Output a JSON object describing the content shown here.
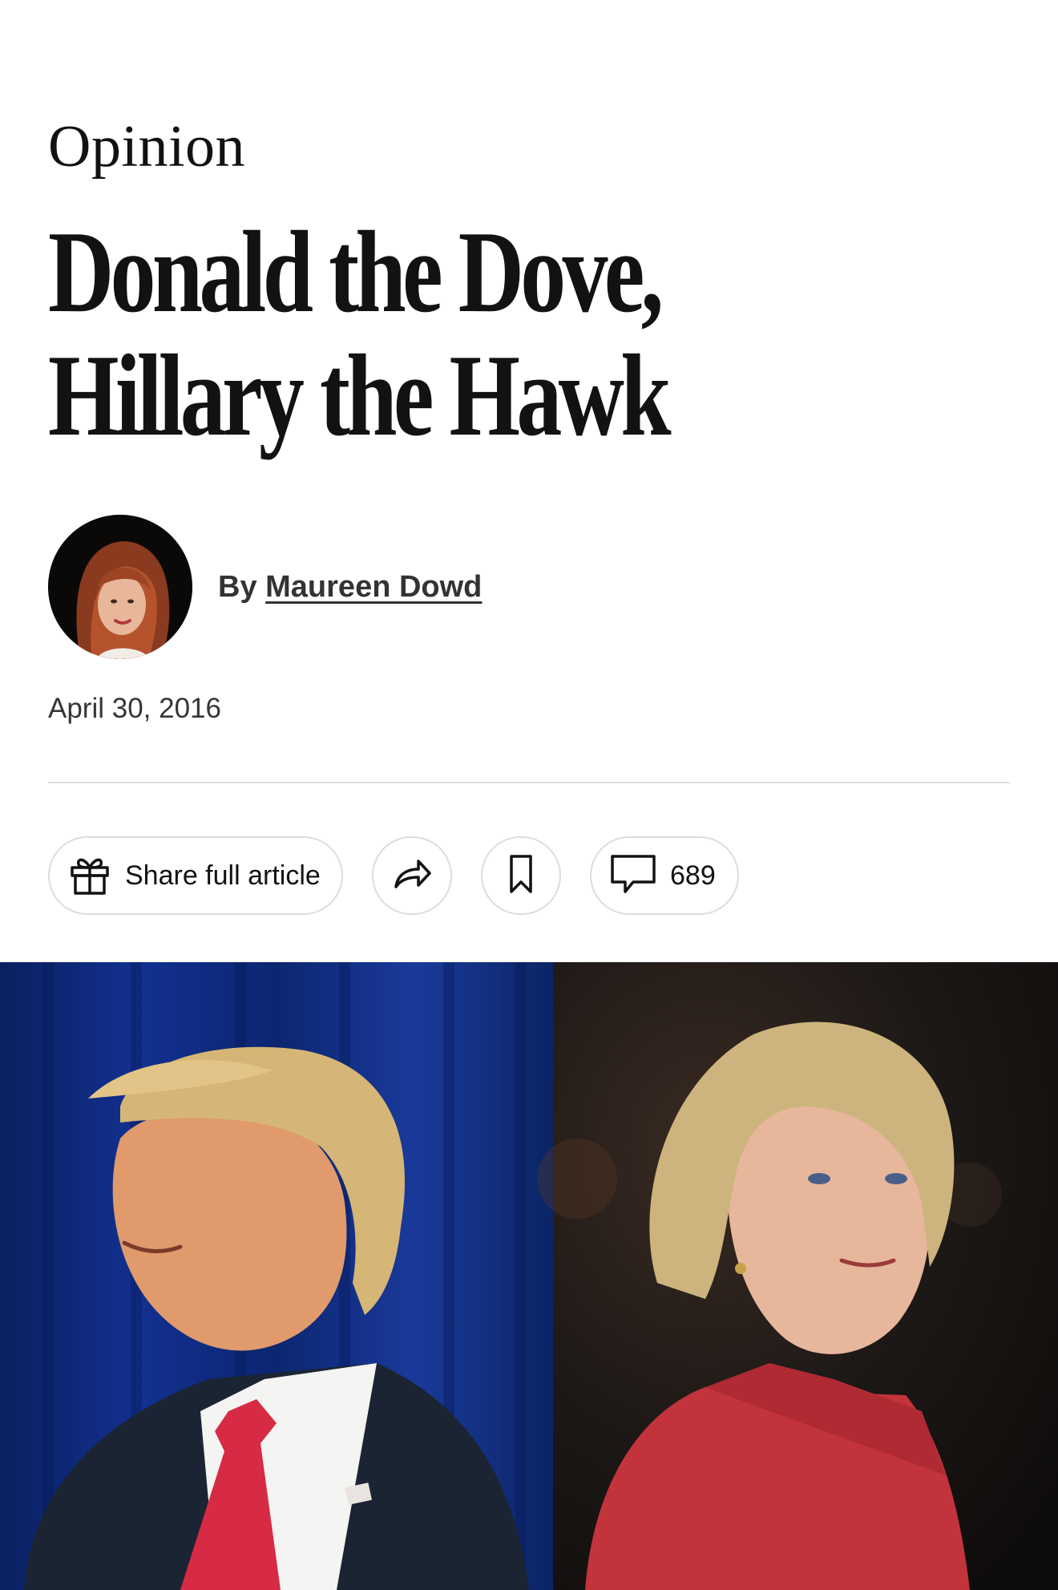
{
  "article": {
    "section_label": "Opinion",
    "headline_line1": "Donald the Dove,",
    "headline_line2": "Hillary the Hawk",
    "byline_prefix": "By",
    "author_name": "Maureen Dowd",
    "date": "April 30, 2016"
  },
  "actions": {
    "share_full_article_label": "Share full article",
    "share_icon": "share-arrow-icon",
    "save_icon": "bookmark-icon",
    "gift_icon": "gift-icon",
    "comment_icon": "comment-bubble-icon",
    "comment_count": "689"
  },
  "colors": {
    "text": "#121212",
    "divider": "#dfdfdf",
    "pill_border": "#dcdcdc",
    "photo_left_bg": "#0c2a74",
    "photo_right_bg": "#1c1816",
    "tie_red": "#d72a44",
    "jacket_red": "#c3333c"
  }
}
